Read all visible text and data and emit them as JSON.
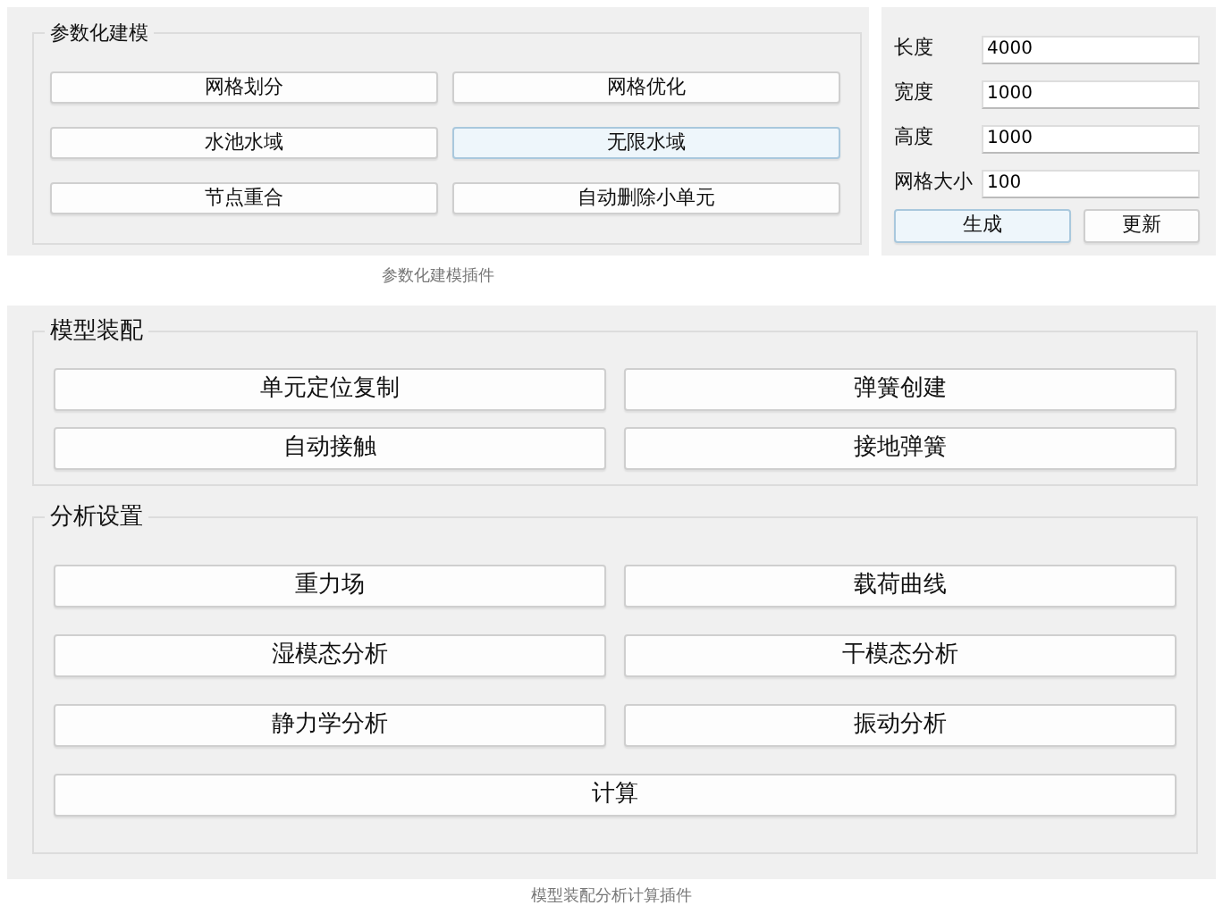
{
  "parametric_modeling": {
    "group_title": "参数化建模",
    "buttons": [
      {
        "label": "网格划分",
        "highlighted": false
      },
      {
        "label": "网格优化",
        "highlighted": false
      },
      {
        "label": "水池水域",
        "highlighted": false
      },
      {
        "label": "无限水域",
        "highlighted": true
      },
      {
        "label": "节点重合",
        "highlighted": false
      },
      {
        "label": "自动删除小单元",
        "highlighted": false
      }
    ],
    "fields": [
      {
        "label": "长度",
        "value": "4000"
      },
      {
        "label": "宽度",
        "value": "1000"
      },
      {
        "label": "高度",
        "value": "1000"
      },
      {
        "label": "网格大小",
        "value": "100"
      }
    ],
    "actions": [
      {
        "label": "生成",
        "highlighted": true
      },
      {
        "label": "更新",
        "highlighted": false
      }
    ],
    "caption": "参数化建模插件"
  },
  "assembly_analysis": {
    "groups": [
      {
        "title": "模型装配",
        "buttons": [
          {
            "label": "单元定位复制"
          },
          {
            "label": "弹簧创建"
          },
          {
            "label": "自动接触"
          },
          {
            "label": "接地弹簧"
          }
        ]
      },
      {
        "title": "分析设置",
        "buttons": [
          {
            "label": "重力场"
          },
          {
            "label": "载荷曲线"
          },
          {
            "label": "湿模态分析"
          },
          {
            "label": "干模态分析"
          },
          {
            "label": "静力学分析"
          },
          {
            "label": "振动分析"
          },
          {
            "label": "计算",
            "wide": true
          }
        ]
      }
    ],
    "caption": "模型装配分析计算插件"
  }
}
